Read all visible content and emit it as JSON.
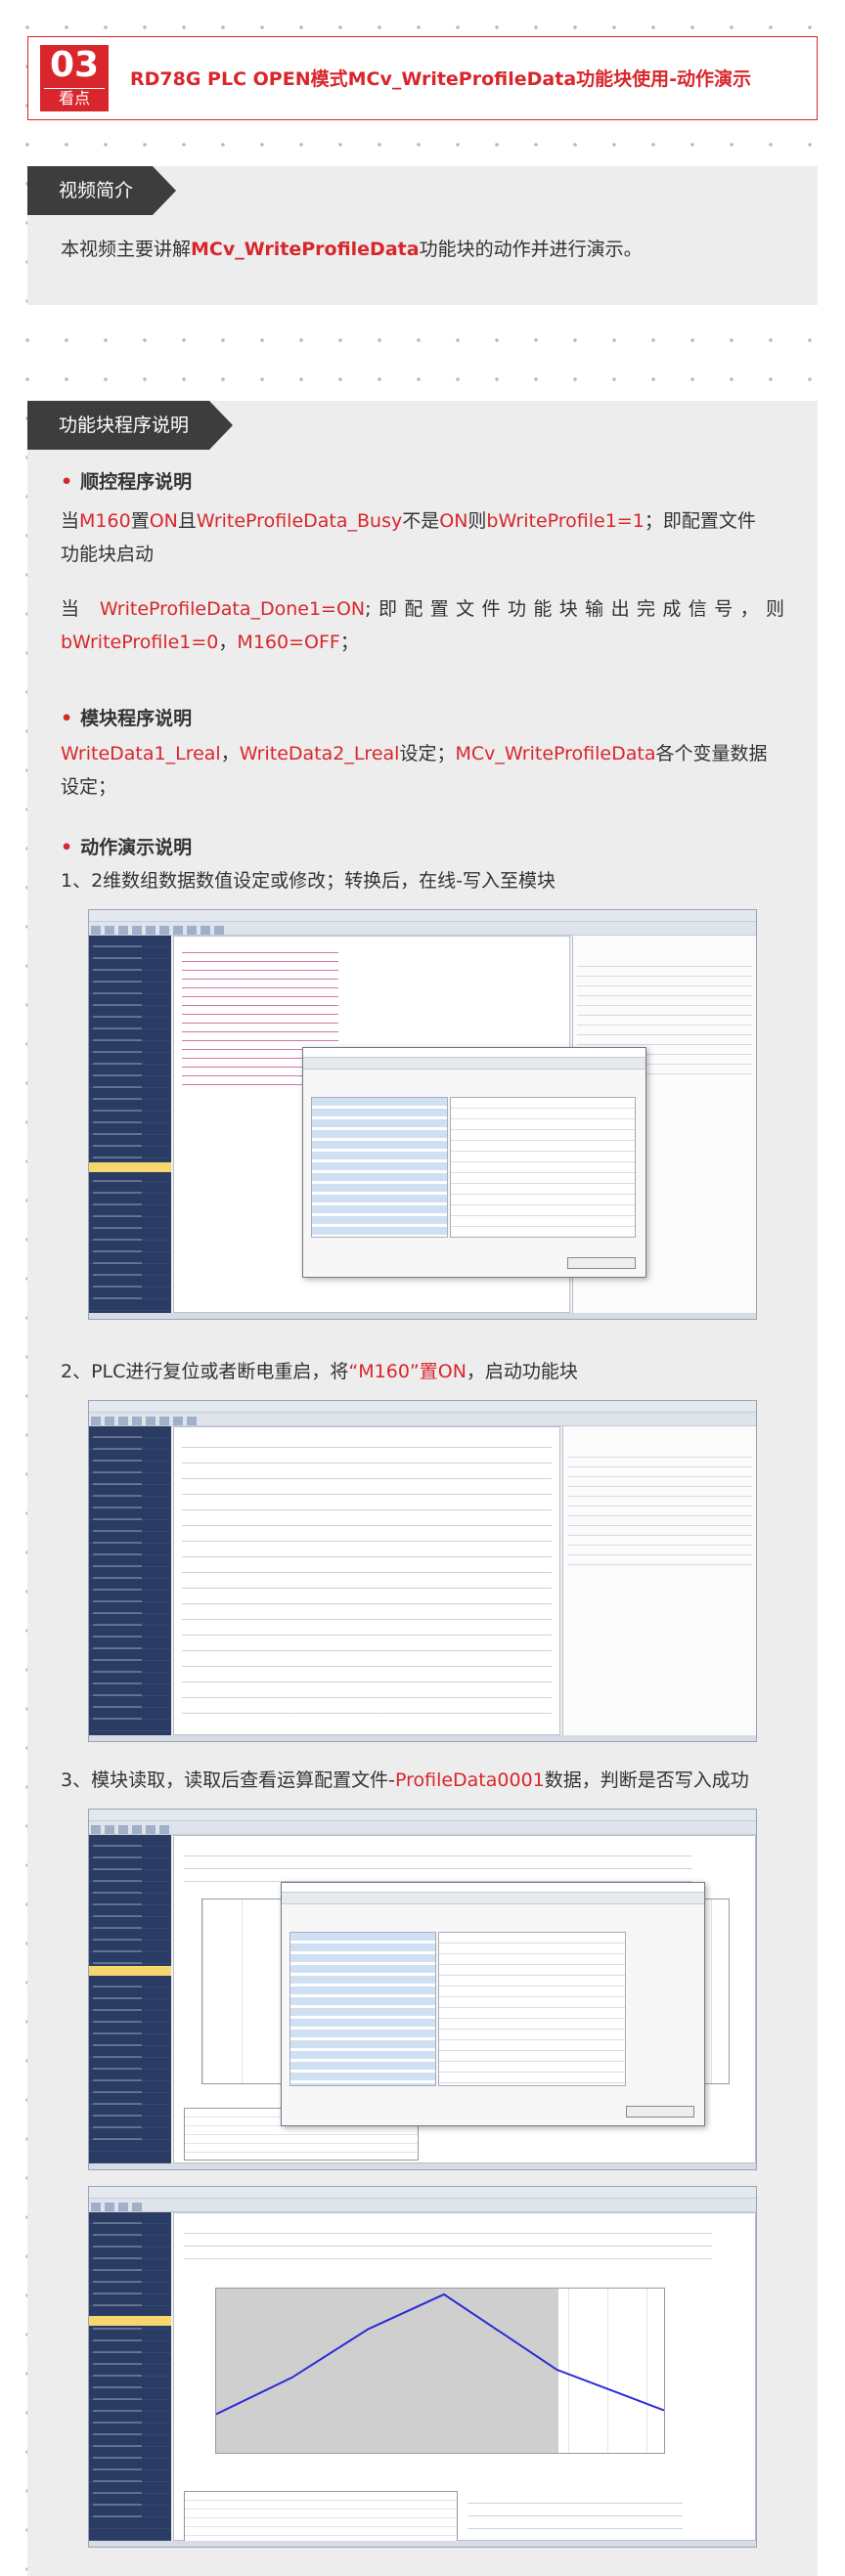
{
  "header": {
    "badge_number": "03",
    "badge_label": "看点",
    "title": "RD78G PLC OPEN模式MCv_WriteProfileData功能块使用-动作演示"
  },
  "intro": {
    "tab_label": "视频简介",
    "text_before": "本视频主要讲解",
    "text_highlight": "MCv_WriteProfileData",
    "text_after": "功能块的动作并进行演示。"
  },
  "program": {
    "tab_label": "功能块程序说明",
    "seq_heading": "顺控程序说明",
    "seq_line1": {
      "p1": "当",
      "p2": "M160",
      "p3": "置",
      "p4": "ON",
      "p5": "且",
      "p6": "WriteProfileData_Busy",
      "p7": "不是",
      "p8": "ON",
      "p9": "则",
      "p10": "bWriteProfile1=1",
      "p11": "；即配置文件",
      "p12": "功能块启动"
    },
    "seq_line2": {
      "p1": "当 ",
      "p2": "WriteProfileData_Done1=ON",
      "p3": ";即配置文件功能块输出完成信号，则",
      "p4": "bWriteProfile1=0",
      "p5": "，",
      "p6": "M160=OFF",
      "p7": "；"
    },
    "module_heading": "模块程序说明",
    "module_line": {
      "p1": "WriteData1_Lreal",
      "p2": "，",
      "p3": "WriteData2_Lreal",
      "p4": "设定；",
      "p5": "MCv_WriteProfileData",
      "p6": "各个变量数据",
      "p7": "设定；"
    },
    "demo_heading": "动作演示说明",
    "step1": "1、2维数组数据数值设定或修改；转换后，在线-写入至模块",
    "step2": {
      "p1": "2、PLC进行复位或者断电重启，将",
      "p2": "“M160”置ON",
      "p3": "，启动功能块"
    },
    "step3": {
      "p1": "3、模块读取，读取后查看运算配置文件-",
      "p2": "ProfileData0001",
      "p3": "数据，判断是否写入成功"
    }
  },
  "colors": {
    "accent": "#d9262c",
    "tab_bg": "#3d3d3d",
    "section_bg": "#ededed"
  }
}
